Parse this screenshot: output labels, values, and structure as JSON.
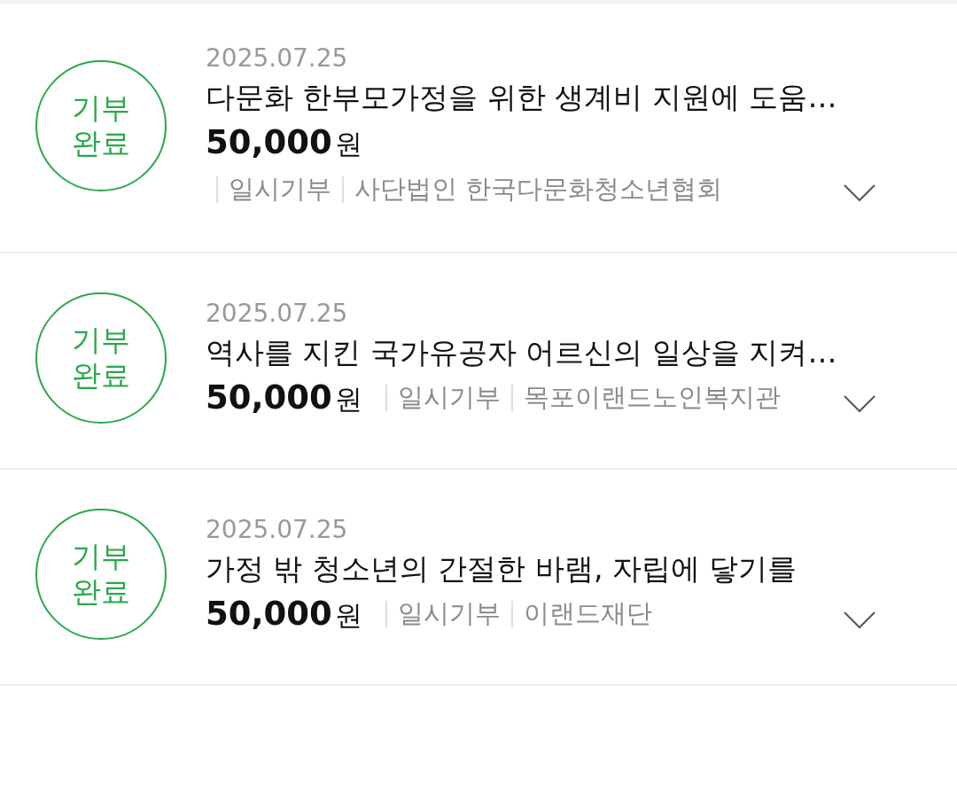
{
  "donations": [
    {
      "badge": "기부 완료",
      "date": "2025.07.25",
      "title": "다문화 한부모가정을 위한 생계비 지원에 도움…",
      "amount": "50,000",
      "currency": "원",
      "donation_type": "일시기부",
      "organization": "사단법인 한국다문화청소년협회"
    },
    {
      "badge": "기부 완료",
      "date": "2025.07.25",
      "title": "역사를 지킨 국가유공자 어르신의 일상을 지켜…",
      "amount": "50,000",
      "currency": "원",
      "donation_type": "일시기부",
      "organization": "목포이랜드노인복지관"
    },
    {
      "badge": "기부 완료",
      "date": "2025.07.25",
      "title": "가정 밖 청소년의 간절한 바램, 자립에 닿기를",
      "amount": "50,000",
      "currency": "원",
      "donation_type": "일시기부",
      "organization": "이랜드재단"
    }
  ]
}
